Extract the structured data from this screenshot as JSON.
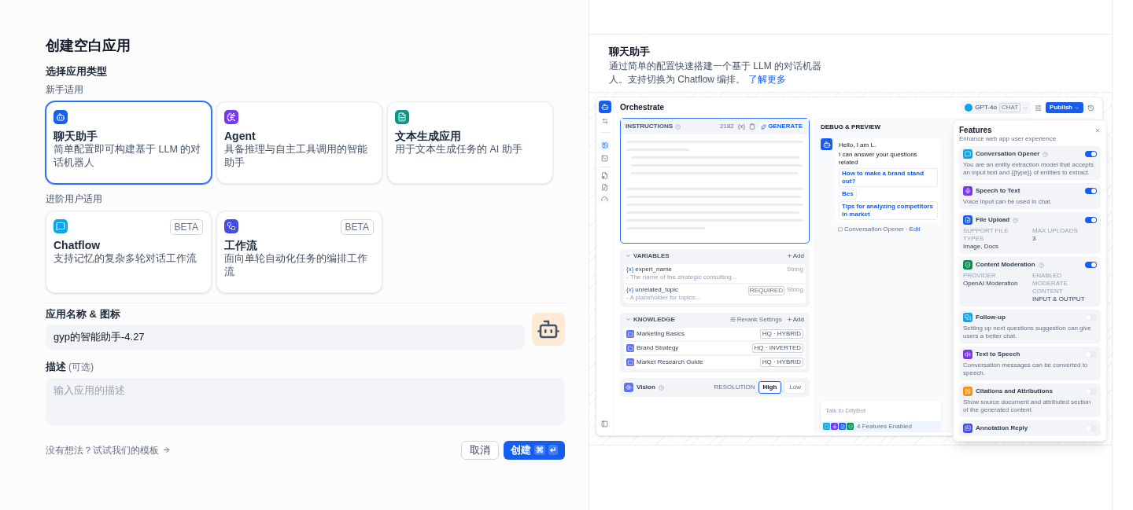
{
  "dialog": {
    "title": "创建空白应用",
    "type_heading": "选择应用类型",
    "groups": [
      {
        "label": "新手适用",
        "types": [
          {
            "name": "聊天助手",
            "description": "简单配置即可构建基于 LLM 的对话机器人",
            "kind": "chat",
            "color": "#155eef",
            "selected": true
          },
          {
            "name": "Agent",
            "description": "具备推理与自主工具调用的智能助手",
            "kind": "agent",
            "color": "#7839ee",
            "selected": false
          },
          {
            "name": "文本生成应用",
            "description": "用于文本生成任务的 AI 助手",
            "kind": "text",
            "color": "#0e9384",
            "selected": false
          }
        ]
      },
      {
        "label": "进阶用户适用",
        "types": [
          {
            "name": "Chatflow",
            "description": "支持记忆的复杂多轮对话工作流",
            "kind": "chatflow",
            "color": "#0ba5ec",
            "badge": "BETA",
            "selected": false
          },
          {
            "name": "工作流",
            "description": "面向单轮自动化任务的编排工作流",
            "kind": "workflow",
            "color": "#444ce7",
            "badge": "BETA",
            "selected": false
          }
        ]
      }
    ],
    "name_label": "应用名称 & 图标",
    "name_value": "gyp的智能助手-4.27",
    "description_label": "描述",
    "description_optional": "(可选)",
    "description_placeholder": "输入应用的描述",
    "template_link": "没有想法？试试我们的模板",
    "cancel": "取消",
    "create": "创建",
    "shortcut": [
      "⌘",
      "↵"
    ]
  },
  "preview": {
    "title": "聊天助手",
    "description": "通过简单的配置快速搭建一个基于 LLM 的对话机器人。支持切换为 Chatflow 编排。",
    "link": "了解更多",
    "mockup": {
      "title": "Orchestrate",
      "model": "GPT-4o",
      "mode": "CHAT",
      "publish": "Publish",
      "instructions": {
        "label": "INSTRUCTIONS",
        "count": "2182",
        "var": "{x}",
        "generate": "GENERATE"
      },
      "variables": {
        "label": "VARIABLES",
        "add": "Add",
        "items": [
          {
            "symbol": "{x}",
            "name": "expert_name",
            "description": "- The name of the strategic consulting...",
            "type": "String"
          },
          {
            "symbol": "{x}",
            "name": "unrelated_topic",
            "description": "- A placeholder for topics...",
            "badge": "REQUIRED",
            "type": "String"
          }
        ]
      },
      "knowledge": {
        "label": "KNOWLEDGE",
        "rerank": "Rerank Settings",
        "add": "Add",
        "items": [
          {
            "name": "Marketing Basics",
            "mode": "HQ · HYBRID"
          },
          {
            "name": "Brand Strategy",
            "mode": "HQ · INVERTED"
          },
          {
            "name": "Market Research Guide",
            "mode": "HQ · HYBRID"
          }
        ]
      },
      "vision": {
        "label": "Vision",
        "resolution_label": "RESOLUTION",
        "options": [
          {
            "label": "High",
            "selected": true
          },
          {
            "label": "Low",
            "selected": false
          }
        ]
      },
      "debug": {
        "title": "DEBUG & PREVIEW",
        "greeting": [
          "Hello, I am L.",
          "I can answer your questions related"
        ],
        "suggestions": [
          [
            "How to make a brand stand out?",
            "Bes"
          ],
          [
            "Tips for analyzing competitors in market"
          ]
        ],
        "opener_label": "Conversation Opener",
        "separator": "·",
        "edit": "Edit",
        "input_placeholder": "Talk to DifyBot",
        "features_enabled": "4 Features Enabled"
      },
      "features": {
        "title": "Features",
        "subtitle": "Enhance web app user experience",
        "items": [
          {
            "kind": "description",
            "color": "#0ba5ec",
            "name": "Conversation Opener",
            "help": true,
            "on": true,
            "text": "You are an entity extraction model that accepts an input text and {{type}} of entities to extract."
          },
          {
            "kind": "description",
            "color": "#7839ee",
            "name": "Speech to Text",
            "help": false,
            "on": true,
            "text": "Voice input can be used in chat."
          },
          {
            "kind": "fields",
            "color": "#155eef",
            "name": "File Upload",
            "help": true,
            "on": true,
            "fields": [
              {
                "label": "SUPPORT FILE TYPES",
                "value": "Image, Docs"
              },
              {
                "label": "MAX UPLOADS",
                "value": "3"
              }
            ]
          },
          {
            "kind": "fields",
            "color": "#099250",
            "name": "Content Moderation",
            "help": true,
            "on": true,
            "fields": [
              {
                "label": "PROVIDER",
                "value": "OpenAI Moderation"
              },
              {
                "label": "ENABLED MODERATE CONTENT",
                "value": "INPUT & OUTPUT"
              }
            ]
          },
          {
            "kind": "description",
            "color": "#0ba5ec",
            "name": "Follow-up",
            "help": false,
            "on": false,
            "text": "Setting up next questions suggestion can give users a better chat."
          },
          {
            "kind": "description",
            "color": "#7839ee",
            "name": "Text to Speech",
            "help": false,
            "on": false,
            "text": "Conversation messages can be converted to speech."
          },
          {
            "kind": "description",
            "color": "#f79009",
            "name": "Citations and Attributions",
            "help": false,
            "on": false,
            "text": "Show source document and attributed section of the generated content."
          },
          {
            "kind": "title",
            "color": "#444ce7",
            "name": "Annotation Reply",
            "help": false,
            "on": false
          }
        ]
      }
    }
  }
}
